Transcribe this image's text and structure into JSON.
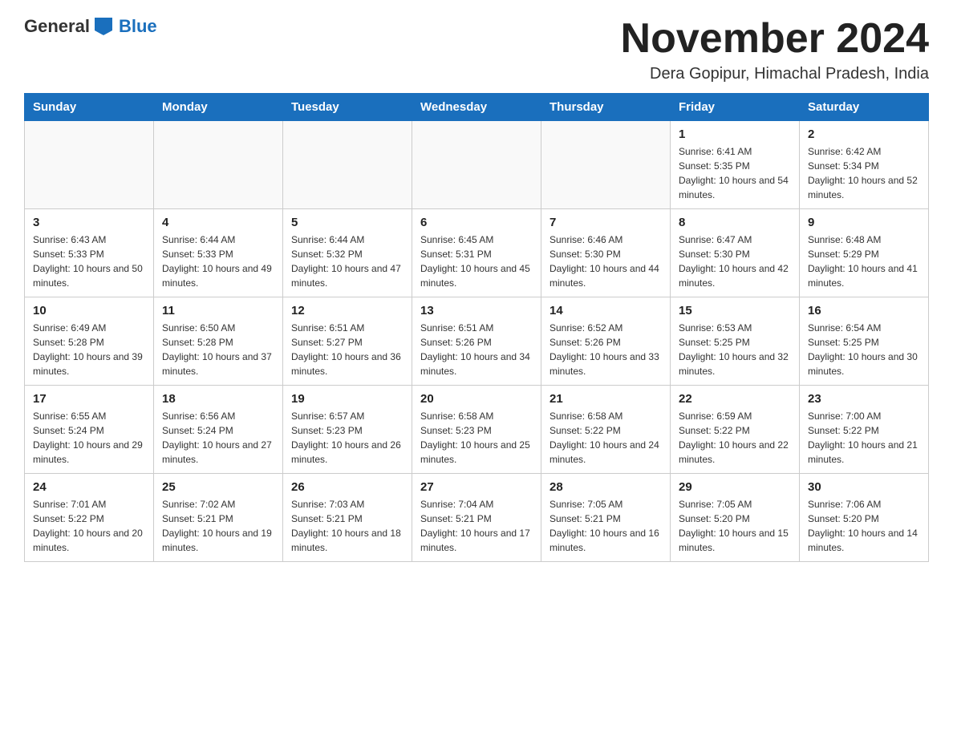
{
  "logo": {
    "general": "General",
    "blue": "Blue"
  },
  "header": {
    "month_year": "November 2024",
    "location": "Dera Gopipur, Himachal Pradesh, India"
  },
  "weekdays": [
    "Sunday",
    "Monday",
    "Tuesday",
    "Wednesday",
    "Thursday",
    "Friday",
    "Saturday"
  ],
  "weeks": [
    [
      {
        "day": "",
        "sunrise": "",
        "sunset": "",
        "daylight": ""
      },
      {
        "day": "",
        "sunrise": "",
        "sunset": "",
        "daylight": ""
      },
      {
        "day": "",
        "sunrise": "",
        "sunset": "",
        "daylight": ""
      },
      {
        "day": "",
        "sunrise": "",
        "sunset": "",
        "daylight": ""
      },
      {
        "day": "",
        "sunrise": "",
        "sunset": "",
        "daylight": ""
      },
      {
        "day": "1",
        "sunrise": "Sunrise: 6:41 AM",
        "sunset": "Sunset: 5:35 PM",
        "daylight": "Daylight: 10 hours and 54 minutes."
      },
      {
        "day": "2",
        "sunrise": "Sunrise: 6:42 AM",
        "sunset": "Sunset: 5:34 PM",
        "daylight": "Daylight: 10 hours and 52 minutes."
      }
    ],
    [
      {
        "day": "3",
        "sunrise": "Sunrise: 6:43 AM",
        "sunset": "Sunset: 5:33 PM",
        "daylight": "Daylight: 10 hours and 50 minutes."
      },
      {
        "day": "4",
        "sunrise": "Sunrise: 6:44 AM",
        "sunset": "Sunset: 5:33 PM",
        "daylight": "Daylight: 10 hours and 49 minutes."
      },
      {
        "day": "5",
        "sunrise": "Sunrise: 6:44 AM",
        "sunset": "Sunset: 5:32 PM",
        "daylight": "Daylight: 10 hours and 47 minutes."
      },
      {
        "day": "6",
        "sunrise": "Sunrise: 6:45 AM",
        "sunset": "Sunset: 5:31 PM",
        "daylight": "Daylight: 10 hours and 45 minutes."
      },
      {
        "day": "7",
        "sunrise": "Sunrise: 6:46 AM",
        "sunset": "Sunset: 5:30 PM",
        "daylight": "Daylight: 10 hours and 44 minutes."
      },
      {
        "day": "8",
        "sunrise": "Sunrise: 6:47 AM",
        "sunset": "Sunset: 5:30 PM",
        "daylight": "Daylight: 10 hours and 42 minutes."
      },
      {
        "day": "9",
        "sunrise": "Sunrise: 6:48 AM",
        "sunset": "Sunset: 5:29 PM",
        "daylight": "Daylight: 10 hours and 41 minutes."
      }
    ],
    [
      {
        "day": "10",
        "sunrise": "Sunrise: 6:49 AM",
        "sunset": "Sunset: 5:28 PM",
        "daylight": "Daylight: 10 hours and 39 minutes."
      },
      {
        "day": "11",
        "sunrise": "Sunrise: 6:50 AM",
        "sunset": "Sunset: 5:28 PM",
        "daylight": "Daylight: 10 hours and 37 minutes."
      },
      {
        "day": "12",
        "sunrise": "Sunrise: 6:51 AM",
        "sunset": "Sunset: 5:27 PM",
        "daylight": "Daylight: 10 hours and 36 minutes."
      },
      {
        "day": "13",
        "sunrise": "Sunrise: 6:51 AM",
        "sunset": "Sunset: 5:26 PM",
        "daylight": "Daylight: 10 hours and 34 minutes."
      },
      {
        "day": "14",
        "sunrise": "Sunrise: 6:52 AM",
        "sunset": "Sunset: 5:26 PM",
        "daylight": "Daylight: 10 hours and 33 minutes."
      },
      {
        "day": "15",
        "sunrise": "Sunrise: 6:53 AM",
        "sunset": "Sunset: 5:25 PM",
        "daylight": "Daylight: 10 hours and 32 minutes."
      },
      {
        "day": "16",
        "sunrise": "Sunrise: 6:54 AM",
        "sunset": "Sunset: 5:25 PM",
        "daylight": "Daylight: 10 hours and 30 minutes."
      }
    ],
    [
      {
        "day": "17",
        "sunrise": "Sunrise: 6:55 AM",
        "sunset": "Sunset: 5:24 PM",
        "daylight": "Daylight: 10 hours and 29 minutes."
      },
      {
        "day": "18",
        "sunrise": "Sunrise: 6:56 AM",
        "sunset": "Sunset: 5:24 PM",
        "daylight": "Daylight: 10 hours and 27 minutes."
      },
      {
        "day": "19",
        "sunrise": "Sunrise: 6:57 AM",
        "sunset": "Sunset: 5:23 PM",
        "daylight": "Daylight: 10 hours and 26 minutes."
      },
      {
        "day": "20",
        "sunrise": "Sunrise: 6:58 AM",
        "sunset": "Sunset: 5:23 PM",
        "daylight": "Daylight: 10 hours and 25 minutes."
      },
      {
        "day": "21",
        "sunrise": "Sunrise: 6:58 AM",
        "sunset": "Sunset: 5:22 PM",
        "daylight": "Daylight: 10 hours and 24 minutes."
      },
      {
        "day": "22",
        "sunrise": "Sunrise: 6:59 AM",
        "sunset": "Sunset: 5:22 PM",
        "daylight": "Daylight: 10 hours and 22 minutes."
      },
      {
        "day": "23",
        "sunrise": "Sunrise: 7:00 AM",
        "sunset": "Sunset: 5:22 PM",
        "daylight": "Daylight: 10 hours and 21 minutes."
      }
    ],
    [
      {
        "day": "24",
        "sunrise": "Sunrise: 7:01 AM",
        "sunset": "Sunset: 5:22 PM",
        "daylight": "Daylight: 10 hours and 20 minutes."
      },
      {
        "day": "25",
        "sunrise": "Sunrise: 7:02 AM",
        "sunset": "Sunset: 5:21 PM",
        "daylight": "Daylight: 10 hours and 19 minutes."
      },
      {
        "day": "26",
        "sunrise": "Sunrise: 7:03 AM",
        "sunset": "Sunset: 5:21 PM",
        "daylight": "Daylight: 10 hours and 18 minutes."
      },
      {
        "day": "27",
        "sunrise": "Sunrise: 7:04 AM",
        "sunset": "Sunset: 5:21 PM",
        "daylight": "Daylight: 10 hours and 17 minutes."
      },
      {
        "day": "28",
        "sunrise": "Sunrise: 7:05 AM",
        "sunset": "Sunset: 5:21 PM",
        "daylight": "Daylight: 10 hours and 16 minutes."
      },
      {
        "day": "29",
        "sunrise": "Sunrise: 7:05 AM",
        "sunset": "Sunset: 5:20 PM",
        "daylight": "Daylight: 10 hours and 15 minutes."
      },
      {
        "day": "30",
        "sunrise": "Sunrise: 7:06 AM",
        "sunset": "Sunset: 5:20 PM",
        "daylight": "Daylight: 10 hours and 14 minutes."
      }
    ]
  ]
}
